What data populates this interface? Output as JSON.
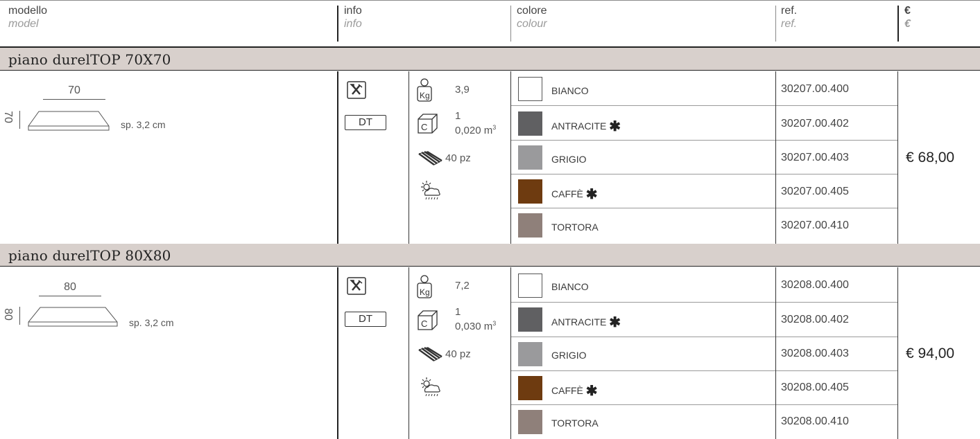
{
  "header": {
    "model_it": "modello",
    "model_en": "model",
    "info_it": "info",
    "info_en": "info",
    "colour_it": "colore",
    "colour_en": "colour",
    "ref_it": "ref.",
    "ref_en": "ref.",
    "price_it": "€",
    "price_en": "€"
  },
  "sections": [
    {
      "title": "piano durelTOP 70X70",
      "dim_width": "70",
      "dim_depth": "70",
      "thickness": "sp. 3,2 cm",
      "info_label": "DT",
      "weight": "3,9",
      "carton_count": "1",
      "carton_volume": "0,020 m",
      "carton_unit_sup": "3",
      "pallet": "40 pz",
      "price": "€ 68,00",
      "colours": [
        {
          "name": "BIANCO",
          "color": "#ffffff",
          "star": "",
          "ref": "30207.00.400"
        },
        {
          "name": "ANTRACITE",
          "color": "#606062",
          "star": "✱",
          "ref": "30207.00.402"
        },
        {
          "name": "GRIGIO",
          "color": "#9a9a9c",
          "star": "",
          "ref": "30207.00.403"
        },
        {
          "name": "CAFFÈ",
          "color": "#6e3b10",
          "star": "✱",
          "ref": "30207.00.405"
        },
        {
          "name": "TORTORA",
          "color": "#8f807a",
          "star": "",
          "ref": "30207.00.410"
        }
      ]
    },
    {
      "title": "piano durelTOP 80X80",
      "dim_width": "80",
      "dim_depth": "80",
      "thickness": "sp. 3,2 cm",
      "info_label": "DT",
      "weight": "7,2",
      "carton_count": "1",
      "carton_volume": "0,030 m",
      "carton_unit_sup": "3",
      "pallet": "40 pz",
      "price": "€ 94,00",
      "colours": [
        {
          "name": "BIANCO",
          "color": "#ffffff",
          "star": "",
          "ref": "30208.00.400"
        },
        {
          "name": "ANTRACITE",
          "color": "#606062",
          "star": "✱",
          "ref": "30208.00.402"
        },
        {
          "name": "GRIGIO",
          "color": "#9a9a9c",
          "star": "",
          "ref": "30208.00.403"
        },
        {
          "name": "CAFFÈ",
          "color": "#6e3b10",
          "star": "✱",
          "ref": "30208.00.405"
        },
        {
          "name": "TORTORA",
          "color": "#8f807a",
          "star": "",
          "ref": "30208.00.410"
        }
      ]
    }
  ]
}
